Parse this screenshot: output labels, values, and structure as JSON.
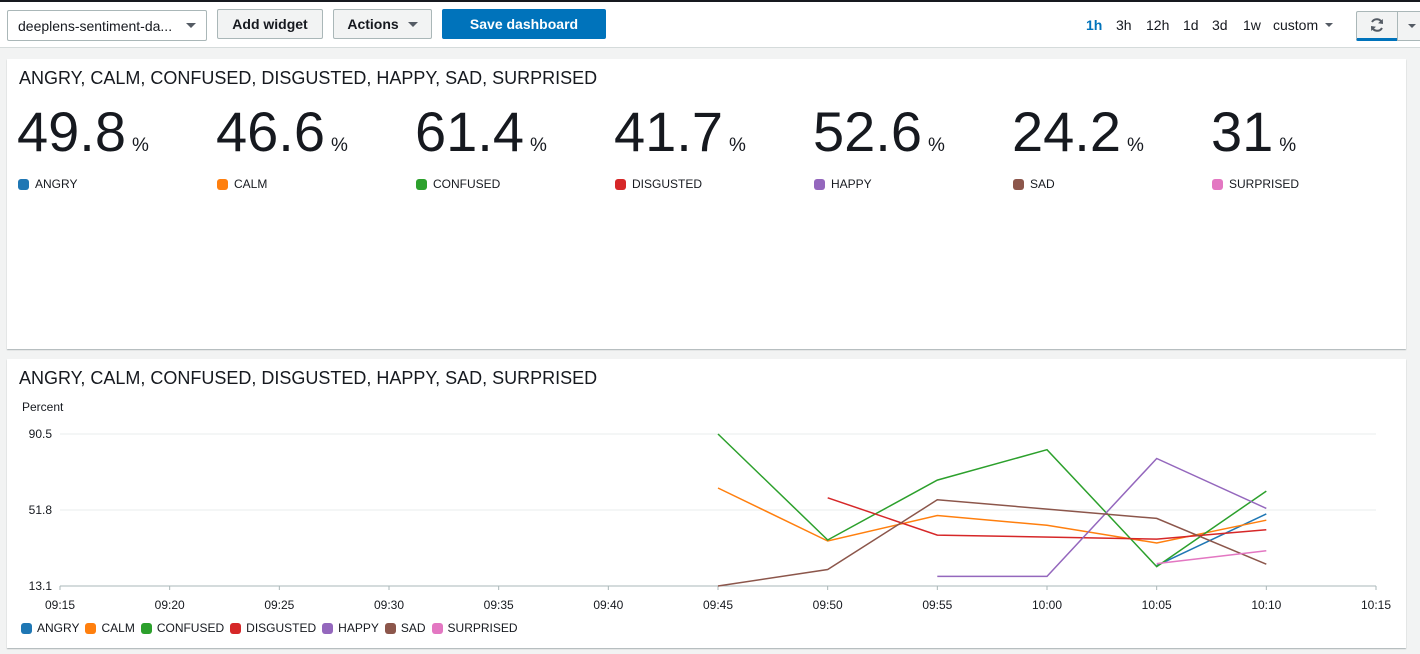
{
  "toolbar": {
    "dashboard_select": "deeplens-sentiment-da...",
    "add_widget": "Add widget",
    "actions": "Actions",
    "save": "Save dashboard",
    "ranges": [
      "1h",
      "3h",
      "12h",
      "1d",
      "3d",
      "1w"
    ],
    "active_range": "1h",
    "custom": "custom",
    "refresh_icon": "refresh-icon"
  },
  "number_widget": {
    "title": "ANGRY, CALM, CONFUSED, DISGUSTED, HAPPY, SAD, SURPRISED",
    "unit": "%",
    "metrics": [
      {
        "label": "ANGRY",
        "value": "49.8"
      },
      {
        "label": "CALM",
        "value": "46.6"
      },
      {
        "label": "CONFUSED",
        "value": "61.4"
      },
      {
        "label": "DISGUSTED",
        "value": "41.7"
      },
      {
        "label": "HAPPY",
        "value": "52.6"
      },
      {
        "label": "SAD",
        "value": "24.2"
      },
      {
        "label": "SURPRISED",
        "value": "31"
      }
    ]
  },
  "colors": {
    "ANGRY": "#1f77b4",
    "CALM": "#ff7f0e",
    "CONFUSED": "#2ca02c",
    "DISGUSTED": "#d62728",
    "HAPPY": "#9467bd",
    "SAD": "#8c564b",
    "SURPRISED": "#e377c2",
    "primary": "#0073bb"
  },
  "line_widget": {
    "title": "ANGRY, CALM, CONFUSED, DISGUSTED, HAPPY, SAD, SURPRISED"
  },
  "chart_data": {
    "type": "line",
    "title": "ANGRY, CALM, CONFUSED, DISGUSTED, HAPPY, SAD, SURPRISED",
    "ylabel": "Percent",
    "xlabel": "",
    "ylim": [
      13.1,
      90.5
    ],
    "y_ticks": [
      "90.5",
      "51.8",
      "13.1"
    ],
    "x_ticks": [
      "09:15",
      "09:20",
      "09:25",
      "09:30",
      "09:35",
      "09:40",
      "09:45",
      "09:50",
      "09:55",
      "10:00",
      "10:05",
      "10:10",
      "10:15"
    ],
    "grid": true,
    "legend": "bottom-left",
    "series": [
      {
        "name": "ANGRY",
        "color": "#1f77b4",
        "points": [
          [
            "10:05",
            23.5
          ],
          [
            "10:10",
            49.8
          ]
        ]
      },
      {
        "name": "CALM",
        "color": "#ff7f0e",
        "points": [
          [
            "09:45",
            63.0
          ],
          [
            "09:50",
            36.0
          ],
          [
            "09:55",
            49.0
          ],
          [
            "10:00",
            44.0
          ],
          [
            "10:05",
            35.0
          ],
          [
            "10:10",
            46.6
          ]
        ]
      },
      {
        "name": "CONFUSED",
        "color": "#2ca02c",
        "points": [
          [
            "09:45",
            90.5
          ],
          [
            "09:50",
            36.5
          ],
          [
            "09:55",
            67.0
          ],
          [
            "10:00",
            82.5
          ],
          [
            "10:05",
            23.0
          ],
          [
            "10:10",
            61.4
          ]
        ]
      },
      {
        "name": "DISGUSTED",
        "color": "#d62728",
        "points": [
          [
            "09:50",
            58.0
          ],
          [
            "09:55",
            39.0
          ],
          [
            "10:05",
            37.0
          ],
          [
            "10:10",
            41.7
          ]
        ]
      },
      {
        "name": "HAPPY",
        "color": "#9467bd",
        "points": [
          [
            "09:55",
            18.0
          ],
          [
            "10:00",
            18.0
          ],
          [
            "10:05",
            78.0
          ],
          [
            "10:10",
            52.6
          ]
        ]
      },
      {
        "name": "SAD",
        "color": "#8c564b",
        "points": [
          [
            "09:45",
            13.1
          ],
          [
            "09:50",
            21.5
          ],
          [
            "09:55",
            57.0
          ],
          [
            "10:05",
            47.5
          ],
          [
            "10:10",
            24.2
          ]
        ]
      },
      {
        "name": "SURPRISED",
        "color": "#e377c2",
        "points": [
          [
            "10:05",
            24.5
          ],
          [
            "10:10",
            31.0
          ]
        ]
      }
    ]
  }
}
